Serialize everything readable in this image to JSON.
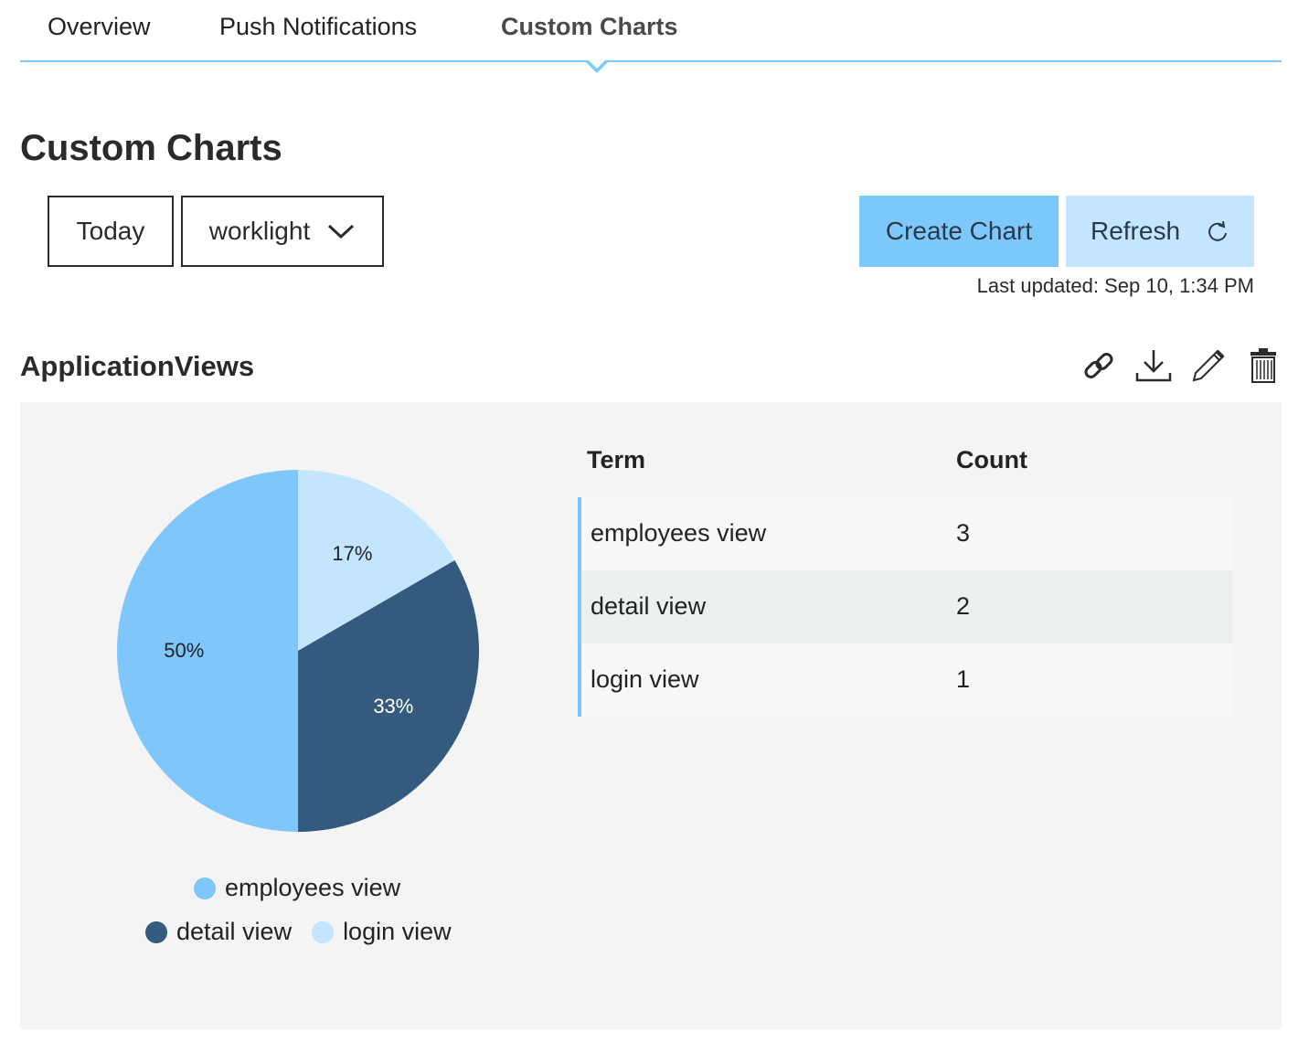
{
  "tabs": [
    {
      "label": "Overview",
      "active": false
    },
    {
      "label": "Push Notifications",
      "active": false
    },
    {
      "label": "Custom Charts",
      "active": true
    }
  ],
  "page_title": "Custom Charts",
  "filters": {
    "date_range": "Today",
    "app_selector": "worklight"
  },
  "actions": {
    "create_chart": "Create Chart",
    "refresh": "Refresh",
    "last_updated": "Last updated: Sep 10, 1:34 PM"
  },
  "chart_section": {
    "title": "ApplicationViews",
    "icons": [
      "link-icon",
      "download-icon",
      "edit-icon",
      "trash-icon"
    ]
  },
  "colors": {
    "accent": "#7cc7fb",
    "employees_view": "#7fc6fb",
    "detail_view": "#345b7d",
    "login_view": "#c3e5fd"
  },
  "chart_data": {
    "type": "pie",
    "categories": [
      "employees view",
      "detail view",
      "login view"
    ],
    "values": [
      3,
      2,
      1
    ],
    "percent_labels": [
      "50%",
      "33%",
      "17%"
    ],
    "legend_placement": "bottom"
  },
  "table": {
    "headers": [
      "Term",
      "Count"
    ],
    "rows": [
      {
        "term": "employees view",
        "count": "3"
      },
      {
        "term": "detail view",
        "count": "2"
      },
      {
        "term": "login view",
        "count": "1"
      }
    ]
  }
}
